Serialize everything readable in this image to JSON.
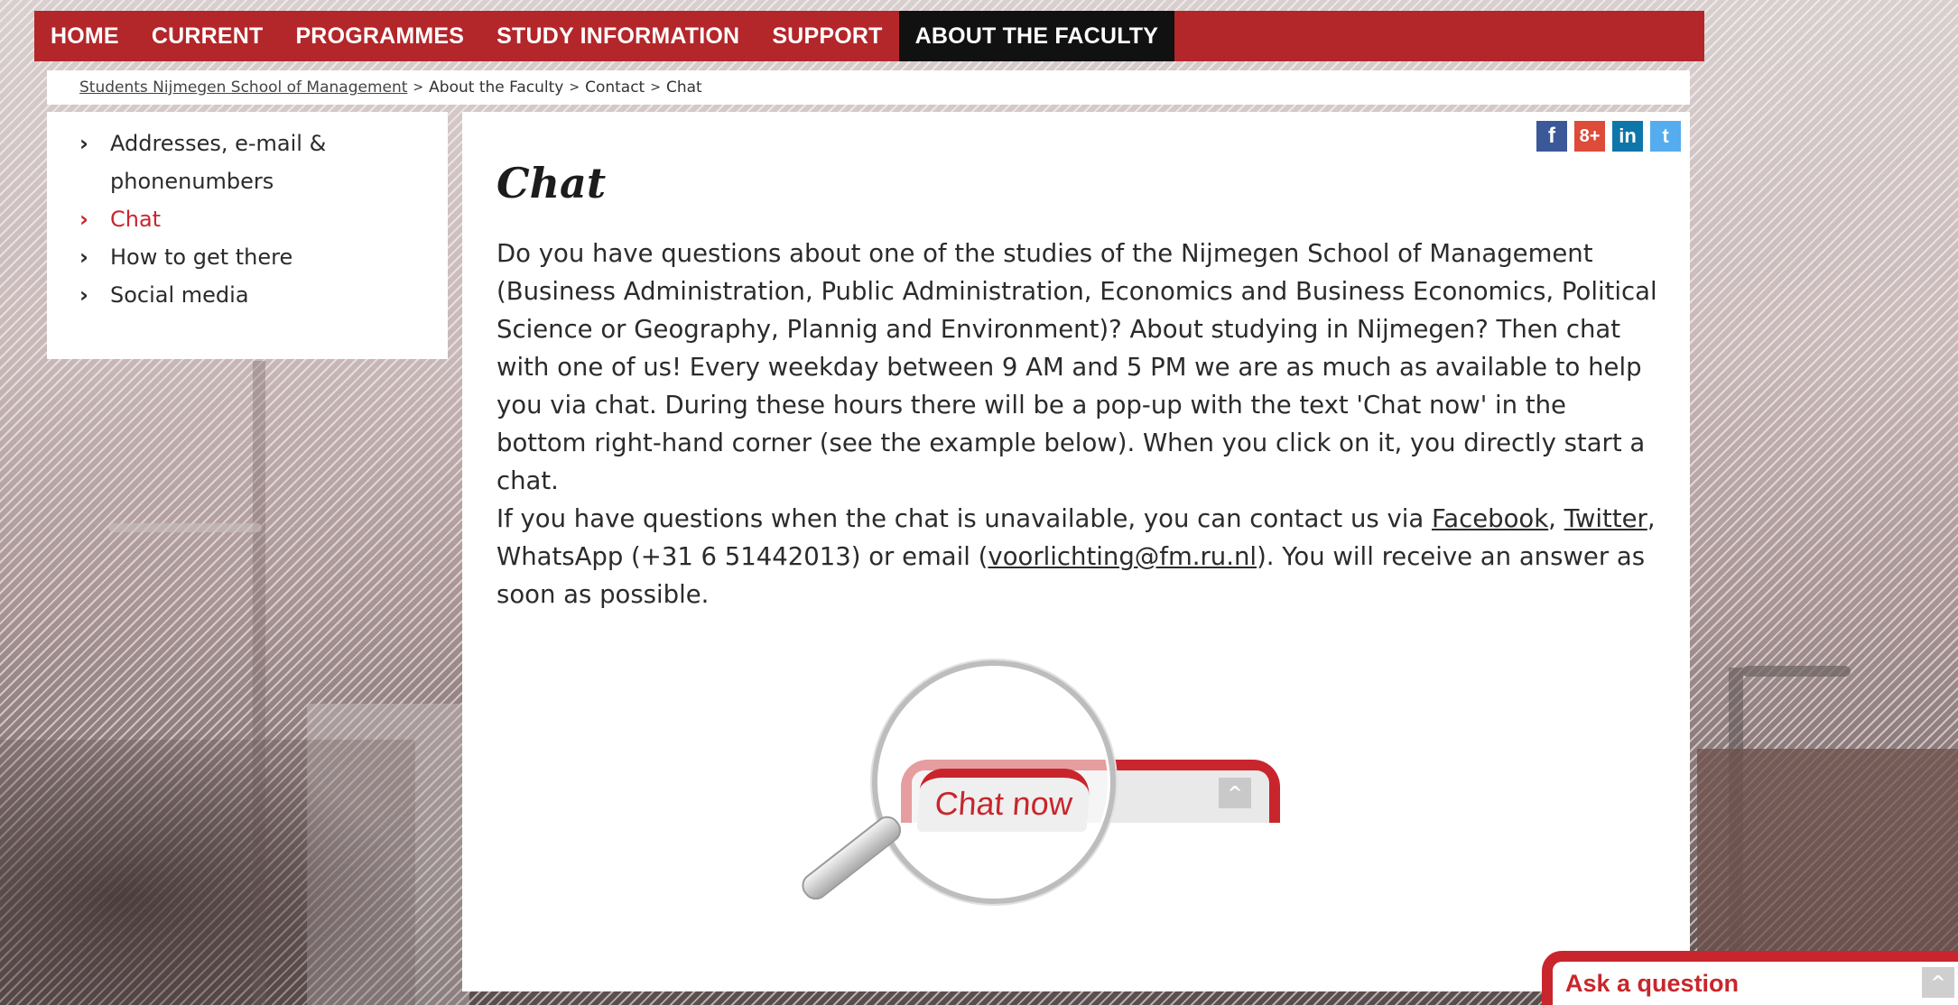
{
  "nav": {
    "items": [
      {
        "label": "HOME"
      },
      {
        "label": "CURRENT"
      },
      {
        "label": "PROGRAMMES"
      },
      {
        "label": "STUDY INFORMATION"
      },
      {
        "label": "SUPPORT"
      },
      {
        "label": "ABOUT THE FACULTY",
        "active": true
      }
    ]
  },
  "breadcrumb": {
    "home": "Students Nijmegen School of Management",
    "sep": ">",
    "items": [
      "About the Faculty",
      "Contact",
      "Chat"
    ]
  },
  "sidebar": {
    "items": [
      {
        "label": "Addresses, e-mail &",
        "label2": "phonenumbers"
      },
      {
        "label": "Chat",
        "active": true
      },
      {
        "label": "How to get there"
      },
      {
        "label": "Social media"
      }
    ],
    "chevron": "›"
  },
  "social": {
    "facebook": "f",
    "googleplus": "8+",
    "linkedin": "in",
    "twitter": "t"
  },
  "main": {
    "title": "Chat",
    "para1": "Do you have questions about one of the studies of the Nijmegen School of Management (Business Administration, Public Administration, Economics and Business Economics, Political Science or Geography, Plannig and Environment)? About studying in Nijmegen? Then chat with one of us! Every weekday between 9 AM and 5 PM we are as much as available to help you via chat. During these hours there will be a pop-up with the text 'Chat now' in the bottom right-hand corner (see the example below). When you click on it, you directly start a chat.",
    "para2_a": "If you have questions when the chat is unavailable, you can contact us via ",
    "link_facebook": "Facebook",
    "comma": ",",
    "link_twitter": "Twitter",
    "para2_b": ", WhatsApp (+31 6 51442013) or email (",
    "link_email": "voorlichting@fm.ru.nl",
    "para2_c": "). You will receive an answer as soon as possible.",
    "example_text": "Chat now"
  },
  "widget": {
    "label": "Ask a question",
    "toggle": "^"
  },
  "colors": {
    "brand_red": "#b3262a",
    "active_nav": "#111111",
    "link_red": "#c8262c"
  }
}
